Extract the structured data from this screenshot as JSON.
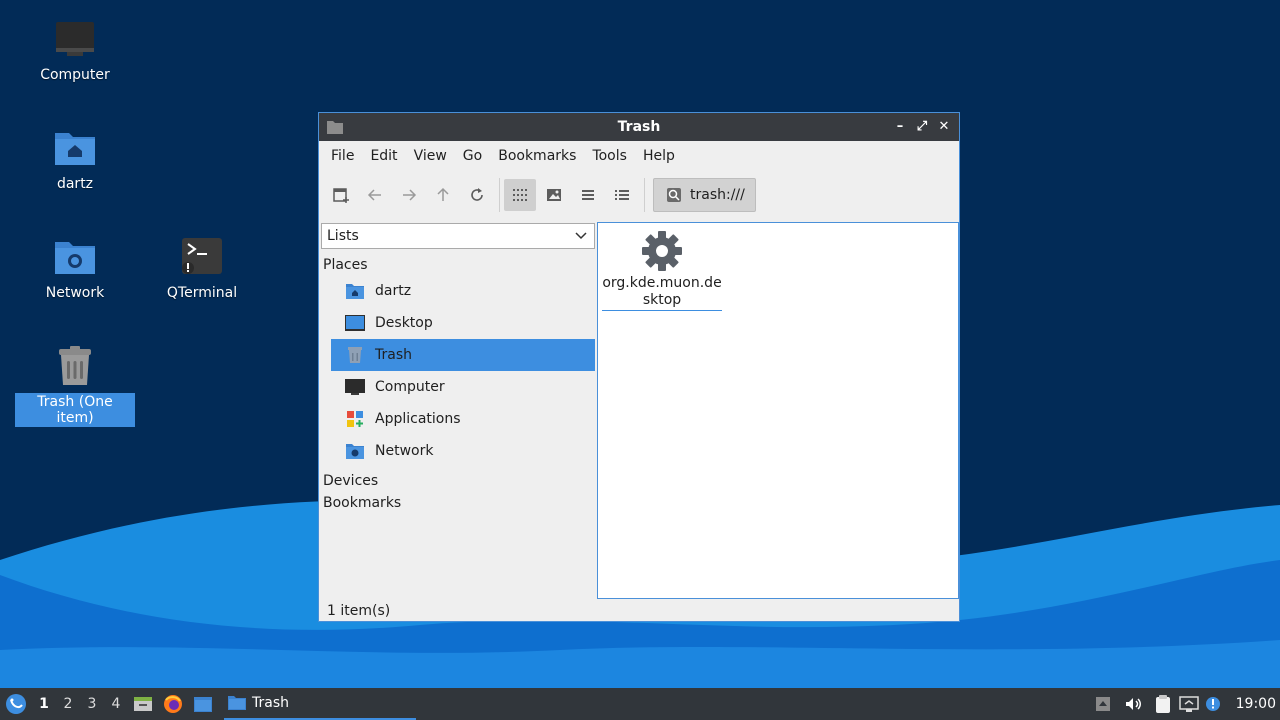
{
  "desktop": {
    "icons": [
      {
        "label": "Computer"
      },
      {
        "label": "dartz"
      },
      {
        "label": "Network"
      },
      {
        "label": "QTerminal"
      },
      {
        "label": "Trash (One item)"
      }
    ]
  },
  "window": {
    "title": "Trash",
    "controls": {
      "minimize": "–",
      "maximize": "⤢",
      "close": "✕"
    },
    "menu": [
      "File",
      "Edit",
      "View",
      "Go",
      "Bookmarks",
      "Tools",
      "Help"
    ],
    "path": "trash:///",
    "side_combo": "Lists",
    "sections": {
      "places": "Places",
      "devices": "Devices",
      "bookmarks": "Bookmarks"
    },
    "places": [
      {
        "label": "dartz",
        "icon": "home-folder-icon"
      },
      {
        "label": "Desktop",
        "icon": "desktop-icon"
      },
      {
        "label": "Trash",
        "icon": "trash-icon",
        "selected": true
      },
      {
        "label": "Computer",
        "icon": "computer-icon"
      },
      {
        "label": "Applications",
        "icon": "applications-icon"
      },
      {
        "label": "Network",
        "icon": "network-folder-icon"
      }
    ],
    "file": {
      "name": "org.kde.muon.desktop",
      "icon": "gear-icon"
    },
    "status": "1 item(s)"
  },
  "taskbar": {
    "workspaces": [
      "1",
      "2",
      "3",
      "4"
    ],
    "task": "Trash",
    "clock": "19:00"
  },
  "colors": {
    "accent": "#3d8ee0",
    "titlebar": "#383b40",
    "taskbar": "#31363b",
    "desktop": "#022b57"
  }
}
